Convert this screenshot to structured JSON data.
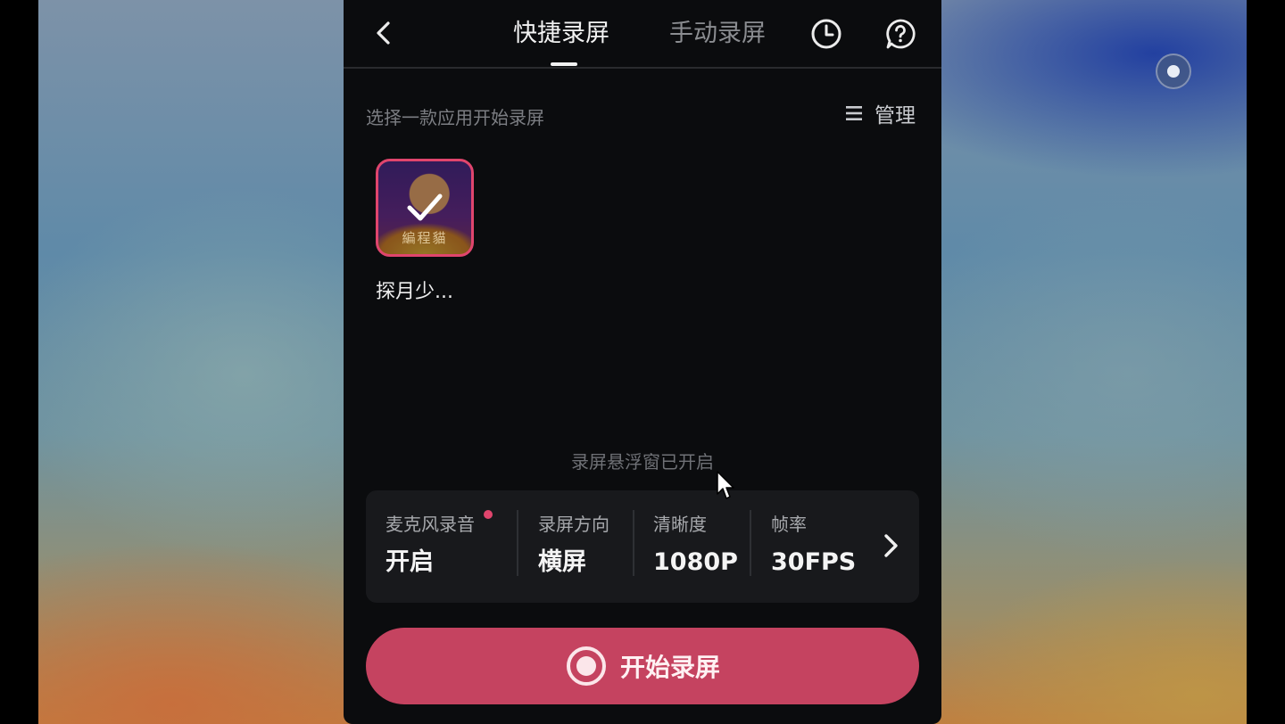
{
  "header": {
    "tabs": [
      {
        "label": "快捷录屏",
        "active": true
      },
      {
        "label": "手动录屏",
        "active": false
      }
    ],
    "icons": [
      "back-icon",
      "history-icon",
      "help-icon"
    ]
  },
  "app_select": {
    "subtitle": "选择一款应用开始录屏",
    "manage_label": "管理",
    "apps": [
      {
        "name": "探月少...",
        "logo_text": "編程貓",
        "selected": true
      }
    ]
  },
  "floating_status": "录屏悬浮窗已开启",
  "settings": [
    {
      "label": "麦克风录音",
      "value": "开启",
      "indicator": "red-dot"
    },
    {
      "label": "录屏方向",
      "value": "横屏"
    },
    {
      "label": "清晰度",
      "value": "1080P"
    },
    {
      "label": "帧率",
      "value": "30FPS"
    }
  ],
  "start_button": {
    "label": "开始录屏"
  },
  "colors": {
    "accent": "#c54360",
    "panel_bg": "#0b0c0e",
    "card_bg": "#18191c"
  }
}
